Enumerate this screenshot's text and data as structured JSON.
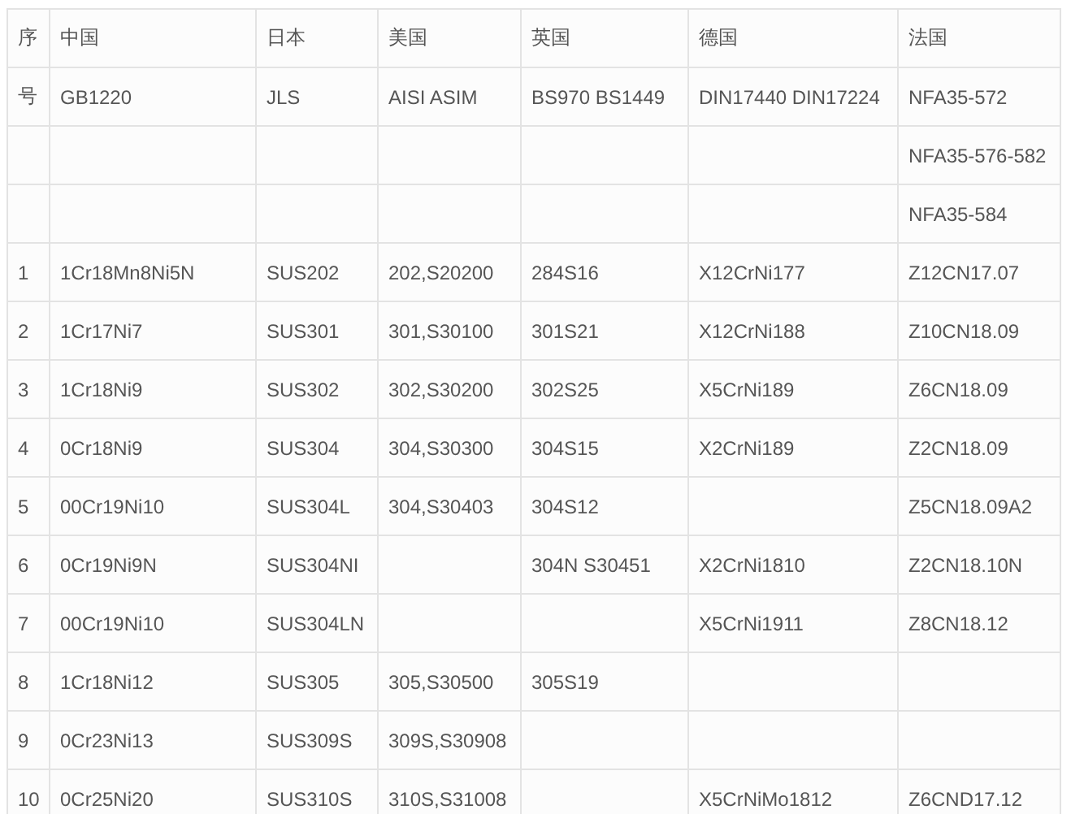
{
  "table": {
    "rows": [
      [
        "序",
        "中国",
        "日本",
        "美国",
        "英国",
        "德国",
        "法国"
      ],
      [
        "号",
        "GB1220",
        "JLS",
        "AISI ASIM",
        "BS970 BS1449",
        "DIN17440 DIN17224",
        "NFA35-572"
      ],
      [
        null,
        null,
        null,
        null,
        null,
        null,
        "NFA35-576-582"
      ],
      [
        null,
        null,
        null,
        null,
        null,
        null,
        "NFA35-584"
      ],
      [
        "1",
        "1Cr18Mn8Ni5N",
        "SUS202",
        "202,S20200",
        "284S16",
        "X12CrNi177",
        "Z12CN17.07"
      ],
      [
        "2",
        "1Cr17Ni7",
        "SUS301",
        "301,S30100",
        "301S21",
        "X12CrNi188",
        "Z10CN18.09"
      ],
      [
        "3",
        "1Cr18Ni9",
        "SUS302",
        "302,S30200",
        "302S25",
        "X5CrNi189",
        "Z6CN18.09"
      ],
      [
        "4",
        "0Cr18Ni9",
        "SUS304",
        "304,S30300",
        "304S15",
        "X2CrNi189",
        "Z2CN18.09"
      ],
      [
        "5",
        "00Cr19Ni10",
        "SUS304L",
        "304,S30403",
        "304S12",
        null,
        "Z5CN18.09A2"
      ],
      [
        "6",
        "0Cr19Ni9N",
        "SUS304NI",
        null,
        "304N S30451",
        "X2CrNi1810",
        "Z2CN18.10N"
      ],
      [
        "7",
        "00Cr19Ni10",
        "SUS304LN",
        null,
        null,
        "X5CrNi1911",
        "Z8CN18.12"
      ],
      [
        "8",
        "1Cr18Ni12",
        "SUS305",
        "305,S30500",
        "305S19",
        null,
        null
      ],
      [
        "9",
        "0Cr23Ni13",
        "SUS309S",
        "309S,S30908",
        null,
        null,
        null
      ],
      [
        "10",
        "0Cr25Ni20",
        "SUS310S",
        "310S,S31008",
        null,
        "X5CrNiMo1812",
        "Z6CND17.12"
      ]
    ]
  }
}
